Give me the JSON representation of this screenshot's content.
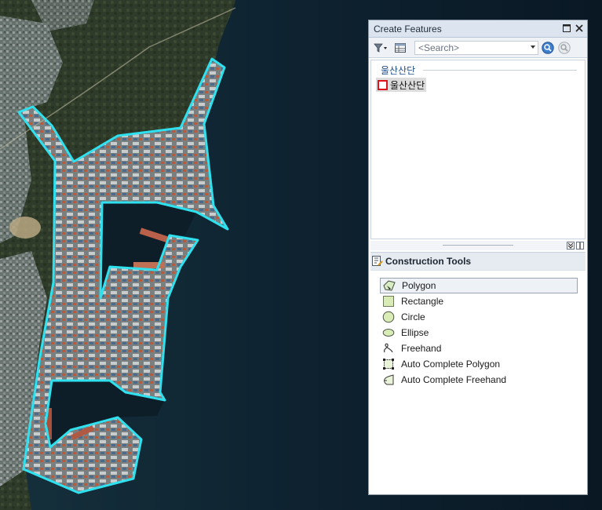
{
  "panel": {
    "title": "Create Features",
    "search_placeholder": "<Search>"
  },
  "templates": {
    "group_name": "울산산단",
    "items": [
      {
        "label": "울산산단",
        "symbol_color": "#e0121c"
      }
    ]
  },
  "construction_tools": {
    "header": "Construction Tools",
    "selected": "Polygon",
    "items": [
      {
        "label": "Polygon",
        "icon": "polygon-icon"
      },
      {
        "label": "Rectangle",
        "icon": "rectangle-icon"
      },
      {
        "label": "Circle",
        "icon": "circle-icon"
      },
      {
        "label": "Ellipse",
        "icon": "ellipse-icon"
      },
      {
        "label": "Freehand",
        "icon": "freehand-icon"
      },
      {
        "label": "Auto Complete Polygon",
        "icon": "auto-complete-polygon-icon"
      },
      {
        "label": "Auto Complete Freehand",
        "icon": "auto-complete-freehand-icon"
      }
    ]
  },
  "map": {
    "feature_outline_color": "#2fe0ee",
    "sea_color": "#0d1d28"
  }
}
